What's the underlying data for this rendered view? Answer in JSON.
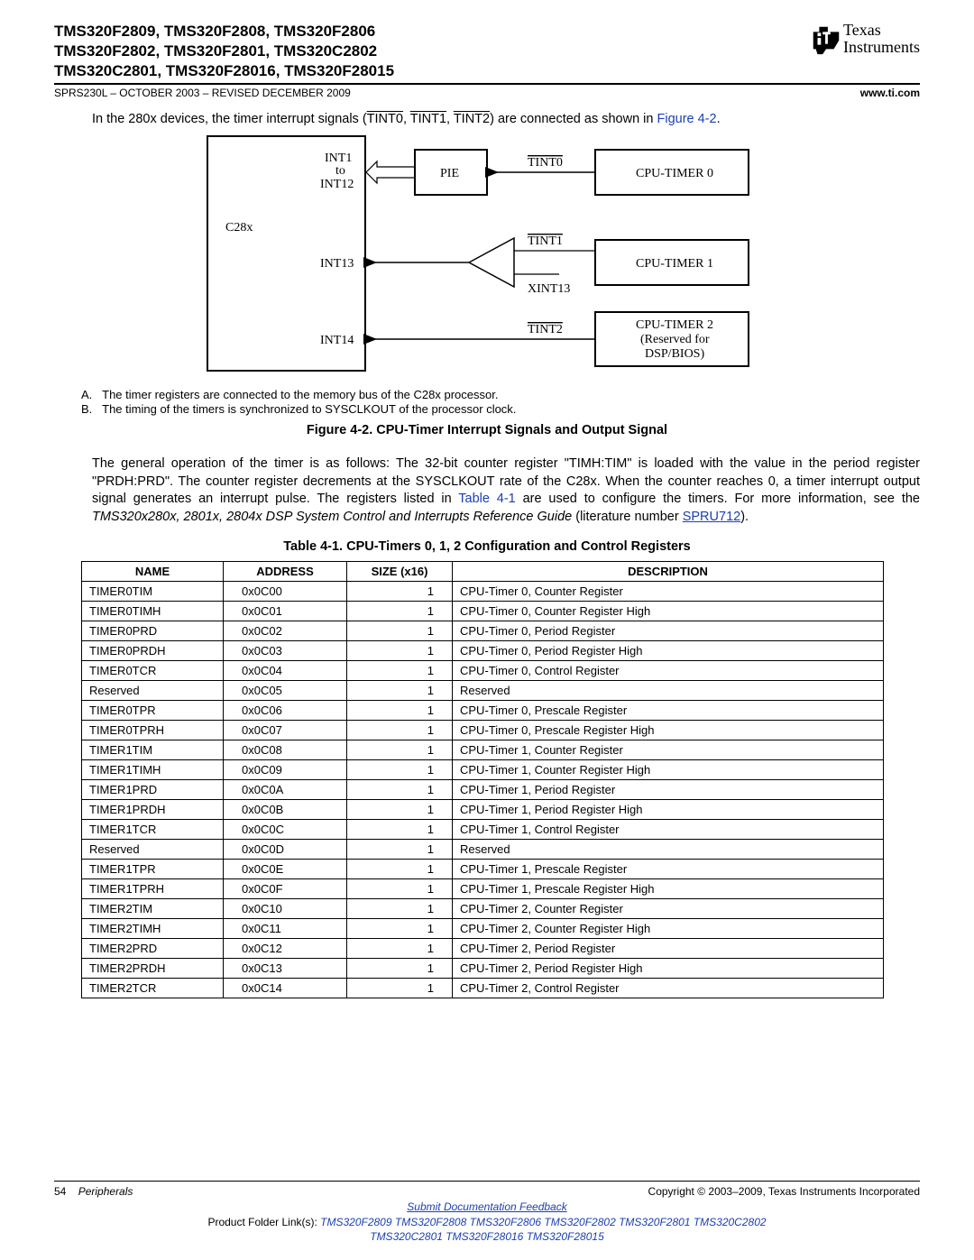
{
  "header": {
    "title_line1": "TMS320F2809, TMS320F2808, TMS320F2806",
    "title_line2": "TMS320F2802, TMS320F2801, TMS320C2802",
    "title_line3": "TMS320C2801, TMS320F28016, TMS320F28015",
    "doc_ref": "SPRS230L – OCTOBER 2003 – REVISED DECEMBER 2009",
    "url": "www.ti.com",
    "logo_brand_top": "Texas",
    "logo_brand_bottom": "Instruments"
  },
  "intro": {
    "pre": "In the 280x devices, the timer interrupt signals (",
    "sig1": "TINT0",
    "sig2": "TINT1",
    "sig3": "TINT2",
    "post": ") are connected as shown in ",
    "figref": "Figure 4-2"
  },
  "diagram": {
    "c28x": "C28x",
    "pie": "PIE",
    "int1": "INT1",
    "int_to": "to",
    "int12": "INT12",
    "int13": "INT13",
    "int14": "INT14",
    "tint0": "TINT0",
    "tint1": "TINT1",
    "tint2": "TINT2",
    "xint13": "XINT13",
    "ct0": "CPU-TIMER 0",
    "ct1": "CPU-TIMER 1",
    "ct2a": "CPU-TIMER 2",
    "ct2b": "(Reserved for",
    "ct2c": "DSP/BIOS)"
  },
  "notes": {
    "a_label": "A.",
    "a_text": "The timer registers are connected to the memory bus of the C28x processor.",
    "b_label": "B.",
    "b_text": "The timing of the timers is synchronized to SYSCLKOUT of the processor clock."
  },
  "fig_caption": "Figure 4-2. CPU-Timer Interrupt Signals and Output Signal",
  "body": {
    "p1a": "The general operation of the timer is as follows: The 32-bit counter register \"TIMH:TIM\" is loaded with the value in the period register \"PRDH:PRD\". The counter register decrements at the SYSCLKOUT rate of the C28x. When the counter reaches 0, a timer interrupt output signal generates an interrupt pulse. The registers listed in ",
    "table_ref": "Table 4-1",
    "p1b": " are used to configure the timers. For more information, see the ",
    "doc_title": "TMS320x280x, 2801x, 2804x DSP System Control and Interrupts Reference Guide",
    "p1c": " (literature number ",
    "lit": "SPRU712",
    "p1d": ")."
  },
  "table_caption": "Table 4-1. CPU-Timers 0, 1, 2 Configuration and Control Registers",
  "table": {
    "headers": {
      "name": "NAME",
      "addr": "ADDRESS",
      "size": "SIZE (x16)",
      "desc": "DESCRIPTION"
    },
    "rows": [
      {
        "name": "TIMER0TIM",
        "addr": "0x0C00",
        "size": "1",
        "desc": "CPU-Timer 0, Counter Register"
      },
      {
        "name": "TIMER0TIMH",
        "addr": "0x0C01",
        "size": "1",
        "desc": "CPU-Timer 0, Counter Register High"
      },
      {
        "name": "TIMER0PRD",
        "addr": "0x0C02",
        "size": "1",
        "desc": "CPU-Timer 0, Period Register"
      },
      {
        "name": "TIMER0PRDH",
        "addr": "0x0C03",
        "size": "1",
        "desc": "CPU-Timer 0, Period Register High"
      },
      {
        "name": "TIMER0TCR",
        "addr": "0x0C04",
        "size": "1",
        "desc": "CPU-Timer 0, Control Register"
      },
      {
        "name": "Reserved",
        "addr": "0x0C05",
        "size": "1",
        "desc": "Reserved"
      },
      {
        "name": "TIMER0TPR",
        "addr": "0x0C06",
        "size": "1",
        "desc": "CPU-Timer 0, Prescale Register"
      },
      {
        "name": "TIMER0TPRH",
        "addr": "0x0C07",
        "size": "1",
        "desc": "CPU-Timer 0, Prescale Register High"
      },
      {
        "name": "TIMER1TIM",
        "addr": "0x0C08",
        "size": "1",
        "desc": "CPU-Timer 1, Counter Register"
      },
      {
        "name": "TIMER1TIMH",
        "addr": "0x0C09",
        "size": "1",
        "desc": "CPU-Timer 1, Counter Register High"
      },
      {
        "name": "TIMER1PRD",
        "addr": "0x0C0A",
        "size": "1",
        "desc": "CPU-Timer 1, Period Register"
      },
      {
        "name": "TIMER1PRDH",
        "addr": "0x0C0B",
        "size": "1",
        "desc": "CPU-Timer 1, Period Register High"
      },
      {
        "name": "TIMER1TCR",
        "addr": "0x0C0C",
        "size": "1",
        "desc": "CPU-Timer 1, Control Register"
      },
      {
        "name": "Reserved",
        "addr": "0x0C0D",
        "size": "1",
        "desc": "Reserved"
      },
      {
        "name": "TIMER1TPR",
        "addr": "0x0C0E",
        "size": "1",
        "desc": "CPU-Timer 1, Prescale Register"
      },
      {
        "name": "TIMER1TPRH",
        "addr": "0x0C0F",
        "size": "1",
        "desc": "CPU-Timer 1, Prescale Register High"
      },
      {
        "name": "TIMER2TIM",
        "addr": "0x0C10",
        "size": "1",
        "desc": "CPU-Timer 2, Counter Register"
      },
      {
        "name": "TIMER2TIMH",
        "addr": "0x0C11",
        "size": "1",
        "desc": "CPU-Timer 2, Counter Register High"
      },
      {
        "name": "TIMER2PRD",
        "addr": "0x0C12",
        "size": "1",
        "desc": "CPU-Timer 2, Period Register"
      },
      {
        "name": "TIMER2PRDH",
        "addr": "0x0C13",
        "size": "1",
        "desc": "CPU-Timer 2, Period Register High"
      },
      {
        "name": "TIMER2TCR",
        "addr": "0x0C14",
        "size": "1",
        "desc": "CPU-Timer 2, Control Register"
      }
    ]
  },
  "footer": {
    "page_num": "54",
    "section": "Peripherals",
    "copyright": "Copyright © 2003–2009, Texas Instruments Incorporated",
    "submit": "Submit Documentation Feedback",
    "folder_label": "Product Folder Link(s): ",
    "links1": [
      "TMS320F2809",
      "TMS320F2808",
      "TMS320F2806",
      "TMS320F2802",
      "TMS320F2801",
      "TMS320C2802"
    ],
    "links2": [
      "TMS320C2801",
      "TMS320F28016",
      "TMS320F28015"
    ]
  }
}
